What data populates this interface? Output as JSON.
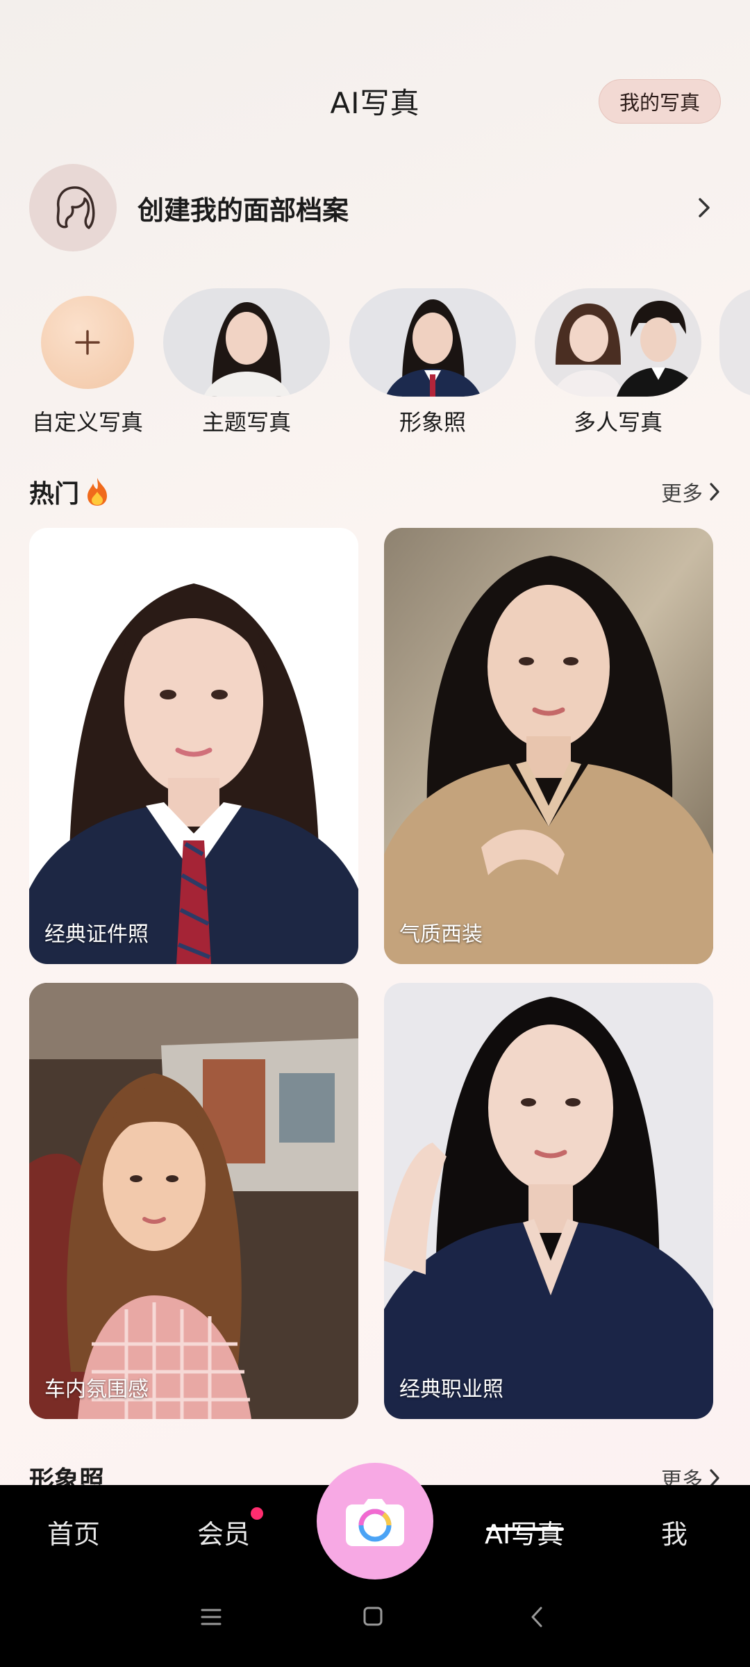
{
  "header": {
    "title": "AI写真",
    "my_photos_label": "我的写真"
  },
  "face_profile": {
    "label": "创建我的面部档案"
  },
  "categories": [
    {
      "label": "自定义写真"
    },
    {
      "label": "主题写真"
    },
    {
      "label": "形象照"
    },
    {
      "label": "多人写真"
    }
  ],
  "hot_section": {
    "title": "热门",
    "more_label": "更多",
    "cards": [
      {
        "label": "经典证件照"
      },
      {
        "label": "气质西装"
      },
      {
        "label": "车内氛围感"
      },
      {
        "label": "经典职业照"
      }
    ]
  },
  "next_section": {
    "title": "形象照",
    "more_label": "更多"
  },
  "bottom_nav": {
    "items": [
      {
        "label": "首页"
      },
      {
        "label": "会员"
      },
      {
        "label": "AI写真"
      },
      {
        "label": "我"
      }
    ],
    "active": "AI写真"
  },
  "colors": {
    "accent_pill": "#f2d9d3",
    "camera_button": "#f7a9e4",
    "badge_dot": "#ff2d6f",
    "nav_background": "#000000"
  },
  "icons": {
    "face_profile": "face-outline-icon",
    "chevron": "chevron-right-icon",
    "plus": "plus-icon",
    "fire": "fire-icon",
    "camera": "camera-icon"
  }
}
